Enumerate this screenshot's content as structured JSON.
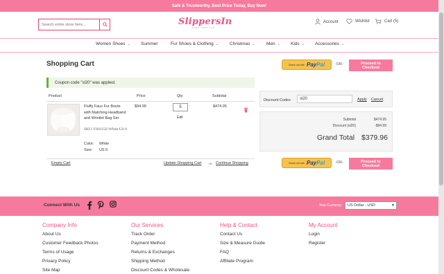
{
  "topbar": {
    "text": "Safe & Trustworthy, Best Price Today, Buy Now!"
  },
  "header": {
    "search_placeholder": "Search entire store here...",
    "logo_text": "SlippersIn",
    "logo_sub": "STEP INSTYLE",
    "account": "Account",
    "wishlist": "Wishlist",
    "cart": "Cart",
    "cart_count": "(5)"
  },
  "nav": [
    {
      "label": "Women Shoes",
      "dropdown": true
    },
    {
      "label": "Summer",
      "dropdown": false
    },
    {
      "label": "Fur Shoes & Clothing",
      "dropdown": true
    },
    {
      "label": "Christmas",
      "dropdown": true
    },
    {
      "label": "Men",
      "dropdown": true
    },
    {
      "label": "Kids",
      "dropdown": true
    },
    {
      "label": "Accessories",
      "dropdown": true
    }
  ],
  "page": {
    "title": "Shopping Cart",
    "paypal_checkout_text": "Check out with",
    "paypal_logo_a": "Pay",
    "paypal_logo_b": "Pal",
    "or": "-OR-",
    "proceed_checkout": "Proceed to Checkout",
    "coupon_message": "Coupon code \"sl20\" was applied."
  },
  "cart": {
    "headers": {
      "product": "Product",
      "price": "Price",
      "qty": "Qty",
      "subtotal": "Subtotal"
    },
    "item": {
      "name": "Fluffy Faux Fur Boots with Matching Headband and Wristlet Bag Set",
      "sku": "SKU: FS01232-White-US 6",
      "color_label": "Color:",
      "color_value": "White",
      "size_label": "Size:",
      "size_value": "US 6",
      "price": "$94.99",
      "qty": "5",
      "edit": "Edit",
      "subtotal": "$474.95"
    },
    "empty": "Empty Cart",
    "update": "Update Shopping Cart",
    "or": "-or-",
    "continue": "Continue Shopping"
  },
  "discount": {
    "label": "Discount Codes",
    "value": "sl20",
    "apply": "Apply",
    "cancel": "Cancel"
  },
  "totals": {
    "subtotal_label": "Subtotal",
    "subtotal_value": "$474.95",
    "discount_label": "Discount (sl20)",
    "discount_value": "-$94.99",
    "grand_label": "Grand Total",
    "grand_value": "$379.96"
  },
  "footer": {
    "connect": "Connect With Us",
    "currency_label": "Your Currency:",
    "currency_value": "US Dollar - USD",
    "columns": [
      {
        "title": "Company Info",
        "links": [
          "About Us",
          "Customer Feedback Photos",
          "Terms of Usage",
          "Privacy Policy",
          "Site Map"
        ]
      },
      {
        "title": "Our Services",
        "links": [
          "Track Order",
          "Payment Method",
          "Returns & Exchanges",
          "Shipping Method",
          "Discount Codes & Wholesale"
        ]
      },
      {
        "title": "Help & Contact",
        "links": [
          "Contact Us",
          "Size & Measure Guide",
          "FAQ",
          "Affiliate Program"
        ]
      },
      {
        "title": "My Account",
        "links": [
          "Login",
          "Register"
        ]
      }
    ]
  },
  "colors": {
    "brand_pink": "#f67a9e",
    "logo_pink": "#f0508a",
    "success_green": "#6fad35",
    "paypal_yellow": "#f7c24c"
  }
}
